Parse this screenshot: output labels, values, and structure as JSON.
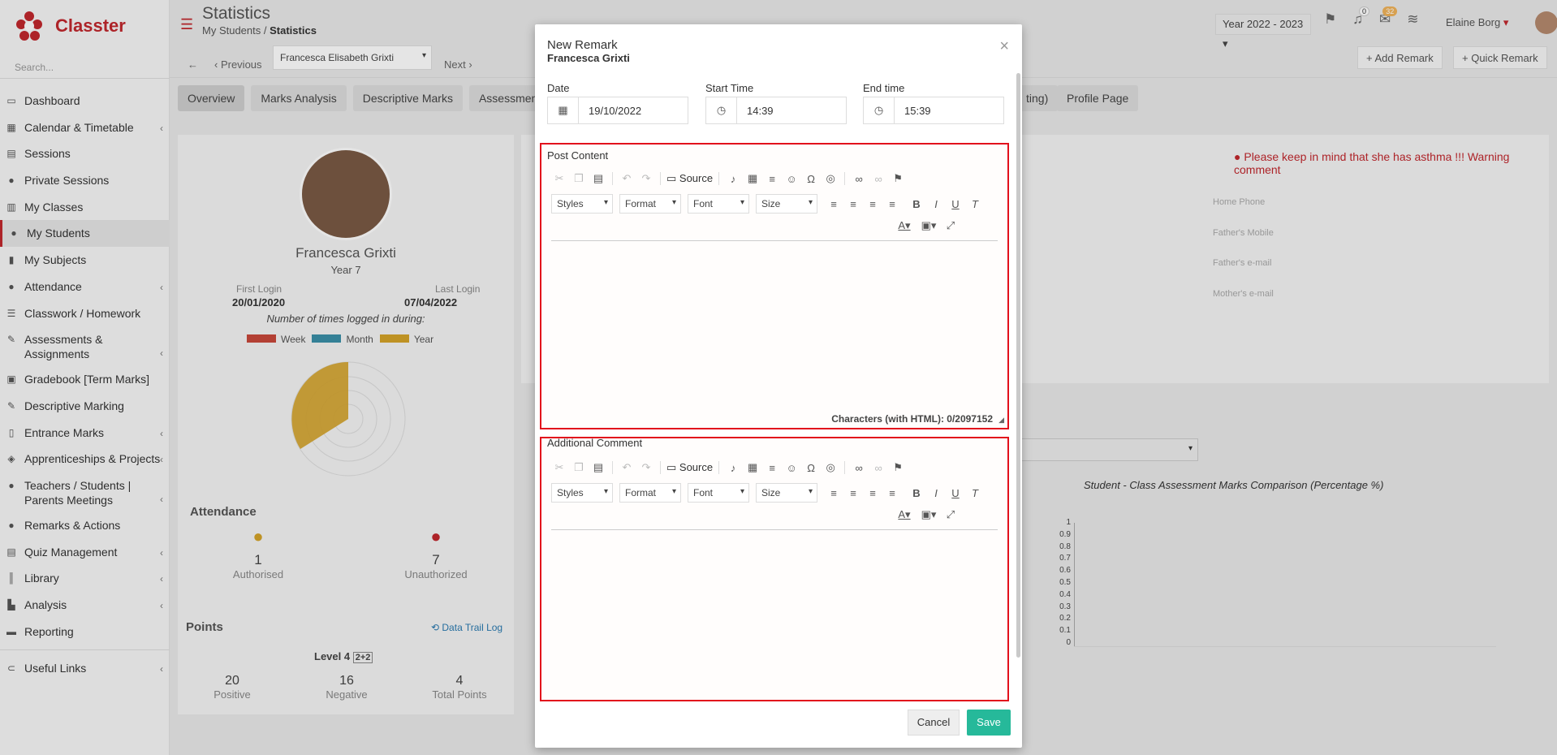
{
  "app": {
    "name": "Classter"
  },
  "sidebar": {
    "search_placeholder": "Search...",
    "items": [
      {
        "label": "Dashboard",
        "icon": "monitor-icon"
      },
      {
        "label": "Calendar & Timetable",
        "icon": "calendar-icon"
      },
      {
        "label": "Sessions",
        "icon": "sessions-icon"
      },
      {
        "label": "Private Sessions",
        "icon": "users-icon"
      },
      {
        "label": "My Classes",
        "icon": "classes-icon"
      },
      {
        "label": "My Students",
        "icon": "students-icon"
      },
      {
        "label": "My Subjects",
        "icon": "book-icon"
      },
      {
        "label": "Attendance",
        "icon": "attendance-icon"
      },
      {
        "label": "Classwork / Homework",
        "icon": "list-icon"
      },
      {
        "label": "Assessments & Assignments",
        "icon": "edit-icon"
      },
      {
        "label": "Gradebook [Term Marks]",
        "icon": "gradebook-icon"
      },
      {
        "label": "Descriptive Marking",
        "icon": "pencil-icon"
      },
      {
        "label": "Entrance Marks",
        "icon": "file-icon"
      },
      {
        "label": "Apprenticeships & Projects",
        "icon": "box-icon"
      },
      {
        "label": "Teachers / Students | Parents Meetings",
        "icon": "meeting-icon"
      },
      {
        "label": "Remarks & Actions",
        "icon": "remarks-icon"
      },
      {
        "label": "Quiz Management",
        "icon": "quiz-icon"
      },
      {
        "label": "Library",
        "icon": "library-icon"
      },
      {
        "label": "Analysis",
        "icon": "chart-icon"
      },
      {
        "label": "Reporting",
        "icon": "print-icon"
      }
    ],
    "useful_links": "Useful Links"
  },
  "header": {
    "title": "Statistics",
    "breadcrumb_parent": "My Students",
    "breadcrumb_current": "Statistics",
    "year": "Year 2022 - 2023",
    "notif_count": "0",
    "mail_count": "32",
    "user_name": "Elaine Borg"
  },
  "subbar": {
    "previous": "Previous",
    "student": "Francesca Elisabeth Grixti",
    "next": "Next",
    "add_remark": "Add Remark",
    "quick_remark": "Quick Remark"
  },
  "tabs": [
    "Overview",
    "Marks Analysis",
    "Descriptive Marks",
    "Assessments",
    "Profile Page",
    "ting)"
  ],
  "profile": {
    "name": "Francesca Grixti",
    "year": "Year 7",
    "first_login_label": "First Login",
    "first_login": "20/01/2020",
    "last_login_label": "Last Login",
    "last_login": "07/04/2022",
    "times_logged": "Number of times logged in during:",
    "legend": [
      {
        "label": "Week",
        "color": "#c8483a"
      },
      {
        "label": "Month",
        "color": "#3a8fa8"
      },
      {
        "label": "Year",
        "color": "#d4a329"
      }
    ]
  },
  "attendance": {
    "title": "Attendance",
    "authorised_count": "1",
    "authorised_label": "Authorised",
    "unauthorized_count": "7",
    "unauthorized_label": "Unauthorized"
  },
  "points": {
    "title": "Points",
    "data_trail": "Data Trail Log",
    "level": "Level 4",
    "positive": "20",
    "positive_label": "Positive",
    "negative": "16",
    "negative_label": "Negative",
    "total": "4",
    "total_label": "Total Points"
  },
  "right_panel": {
    "warning": "Please keep in mind that she has asthma !!! Warning comment",
    "info_labels": [
      "Home Phone",
      "Father's Mobile",
      "Father's e-mail",
      "Mother's e-mail"
    ],
    "chart_title": "Student - Class Assessment Marks Comparison (Percentage %)",
    "y_ticks": [
      "1",
      "0.9",
      "0.8",
      "0.7",
      "0.6",
      "0.5",
      "0.4",
      "0.3",
      "0.2",
      "0.1",
      "0"
    ]
  },
  "modal": {
    "title": "New Remark",
    "subtitle": "Francesca Grixti",
    "date_label": "Date",
    "date_value": "19/10/2022",
    "start_label": "Start Time",
    "start_value": "14:39",
    "end_label": "End time",
    "end_value": "15:39",
    "post_content_label": "Post Content",
    "additional_comment_label": "Additional Comment",
    "source": "Source",
    "styles": "Styles",
    "format": "Format",
    "font": "Font",
    "size": "Size",
    "char_count": "Characters (with HTML): 0/2097152",
    "cancel": "Cancel",
    "save": "Save"
  }
}
